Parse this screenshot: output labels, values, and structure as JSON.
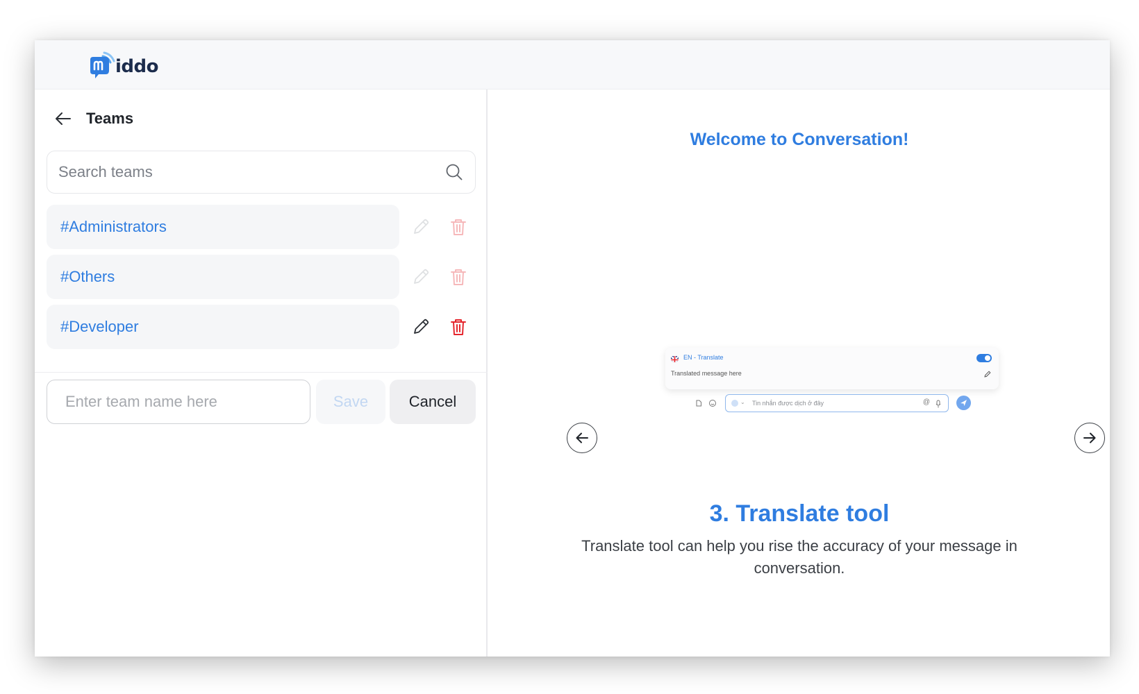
{
  "brand": {
    "logo_text": "iddo"
  },
  "teams_panel": {
    "title": "Teams",
    "search": {
      "placeholder": "Search teams"
    },
    "teams": [
      {
        "name": "#Administrators",
        "actions_enabled": false
      },
      {
        "name": "#Others",
        "actions_enabled": false
      },
      {
        "name": "#Developer",
        "actions_enabled": true
      }
    ],
    "new_team": {
      "placeholder": "Enter team name here",
      "value": ""
    },
    "save_label": "Save",
    "cancel_label": "Cancel"
  },
  "onboarding": {
    "welcome": "Welcome to Conversation!",
    "preview": {
      "language_label": "EN - Translate",
      "translated_text": "Translated message here",
      "input_placeholder": "Tin nhắn được dịch ở đây"
    },
    "slide_title": "3. Translate tool",
    "slide_description": "Translate tool can help you rise the accuracy of your message in conversation."
  },
  "colors": {
    "accent": "#2f7de0",
    "danger": "#e5262d",
    "text": "#1f2329"
  }
}
